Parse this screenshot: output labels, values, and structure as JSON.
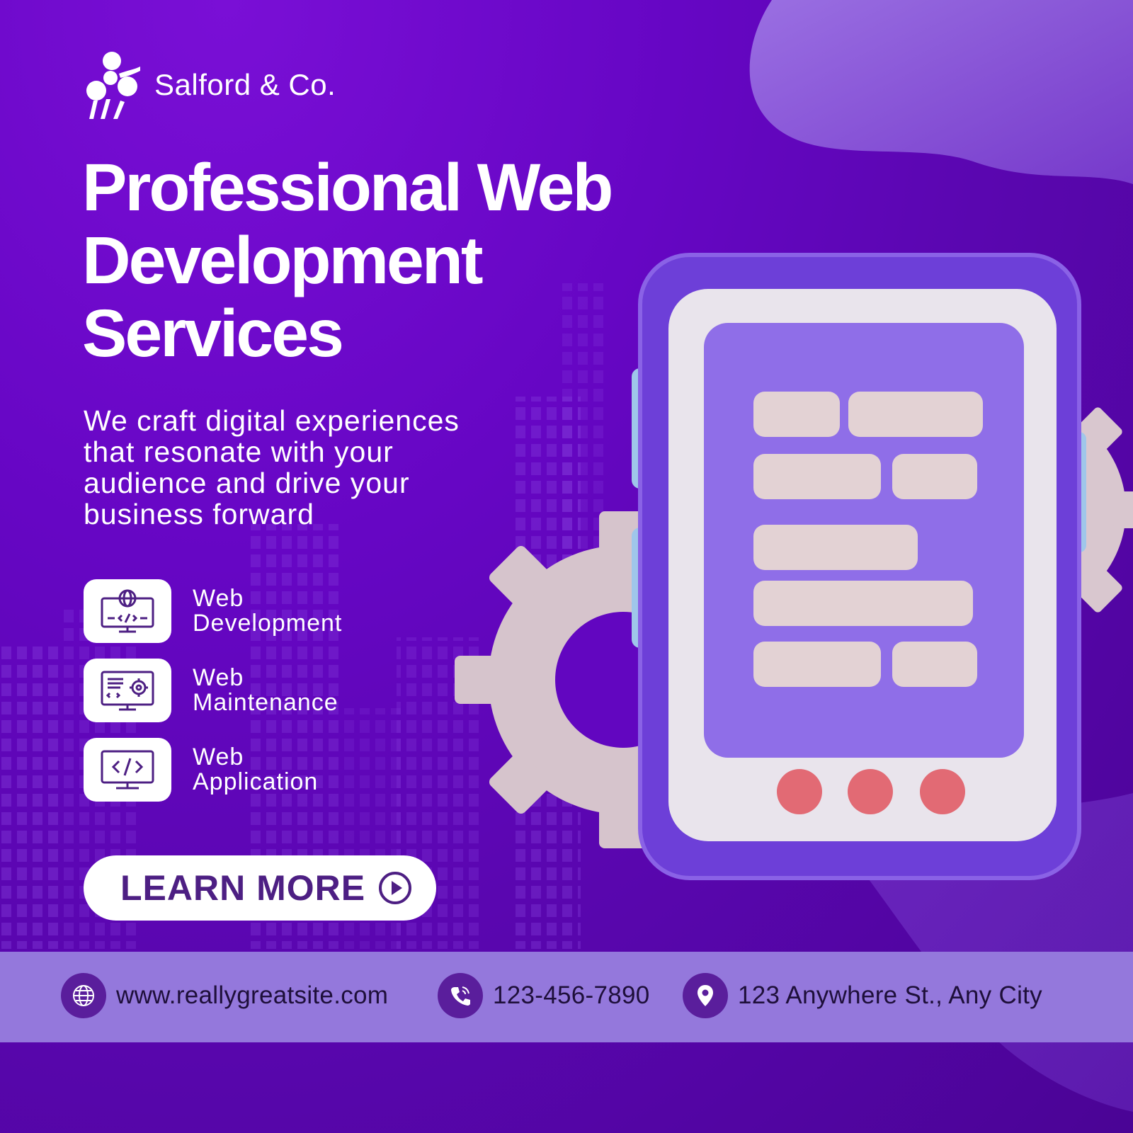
{
  "brand": {
    "name": "Salford & Co.",
    "logo": "people-cluster-logo"
  },
  "headline": {
    "line1": "Professional Web",
    "line2": "Development",
    "line3": "Services"
  },
  "subtext": {
    "line1": "We craft digital experiences",
    "line2": "that resonate with your",
    "line3": "audience and drive your",
    "line4": "business forward"
  },
  "services": [
    {
      "line1": "Web",
      "line2": "Development",
      "icon": "monitor-globe-code-icon"
    },
    {
      "line1": "Web",
      "line2": "Maintenance",
      "icon": "monitor-settings-icon"
    },
    {
      "line1": "Web",
      "line2": "Application",
      "icon": "monitor-code-icon"
    }
  ],
  "cta": {
    "label": "LEARN MORE",
    "icon": "play-circle-icon"
  },
  "contact": {
    "website": "www.reallygreatsite.com",
    "phone": "123-456-7890",
    "address": "123 Anywhere St., Any City"
  },
  "colors": {
    "background": "#6606c4",
    "footer_bar": "#9478dc",
    "accent_dark": "#4d1f83",
    "icon_circle": "#5a1e9c",
    "text_light": "#ffffff"
  }
}
